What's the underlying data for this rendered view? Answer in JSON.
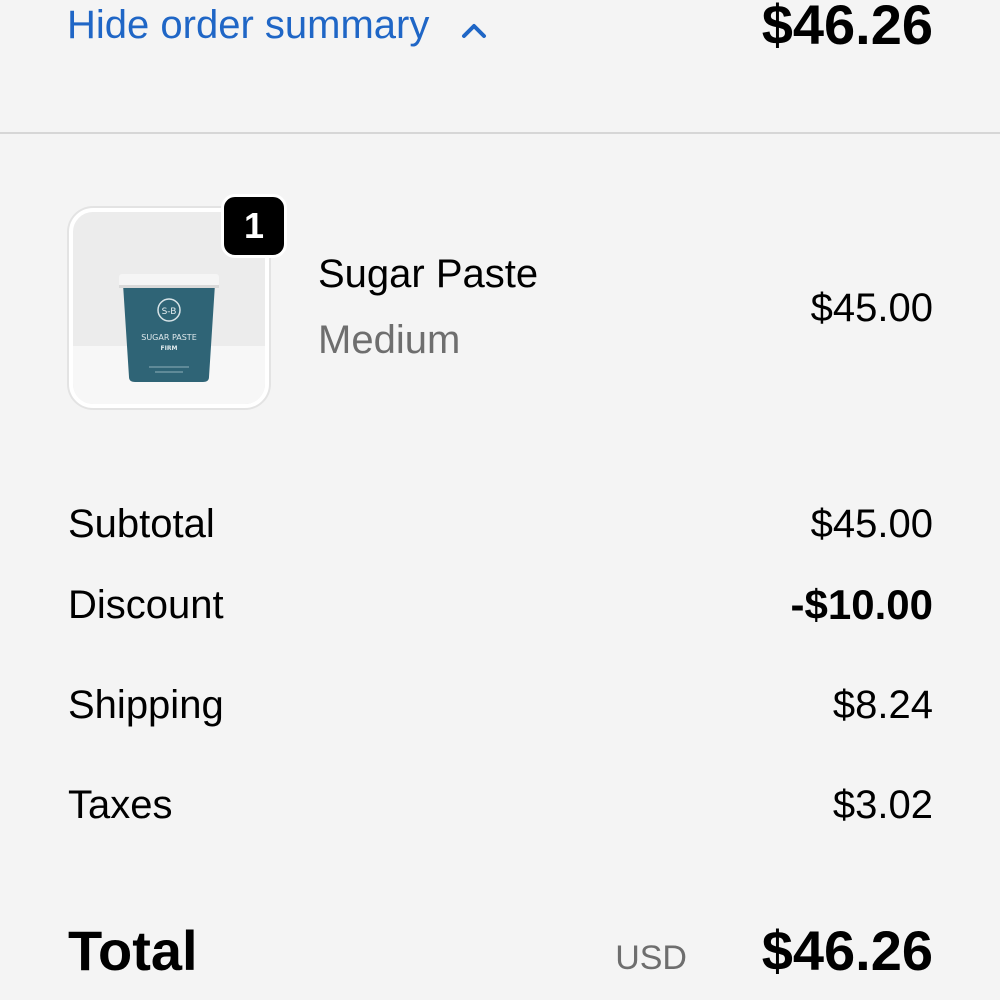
{
  "summary_toggle": {
    "label": "Hide order summary",
    "icon": "chevron-up-icon",
    "color": "#1f66c6"
  },
  "header_total": "$46.26",
  "line_item": {
    "quantity": "1",
    "name": "Sugar Paste",
    "variant": "Medium",
    "price": "$45.00",
    "image": {
      "brand_mark": "S-B",
      "label_line1": "SUGAR PASTE",
      "label_line2": "FIRM",
      "tub_color": "#2f6476"
    }
  },
  "breakdown": {
    "subtotal": {
      "label": "Subtotal",
      "value": "$45.00"
    },
    "discount": {
      "label": "Discount",
      "value": "-$10.00"
    },
    "shipping": {
      "label": "Shipping",
      "value": "$8.24"
    },
    "taxes": {
      "label": "Taxes",
      "value": "$3.02"
    }
  },
  "total": {
    "label": "Total",
    "currency": "USD",
    "amount": "$46.26"
  }
}
